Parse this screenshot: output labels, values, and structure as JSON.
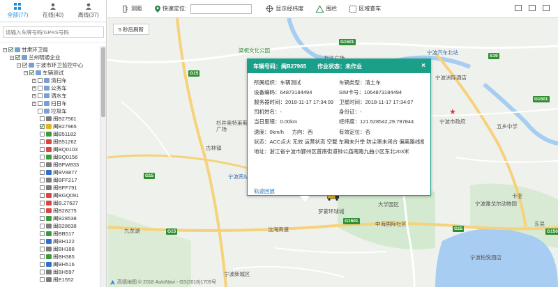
{
  "tabs": [
    {
      "label": "全部(77)",
      "icon": "grid-icon",
      "active": true
    },
    {
      "label": "在线(40)",
      "icon": "user-online-icon",
      "active": false
    },
    {
      "label": "离线(37)",
      "icon": "user-offline-icon",
      "active": false
    }
  ],
  "search": {
    "placeholder": "请输入车牌号码/GPRS号码"
  },
  "tree": {
    "root": "甘肃环卫局",
    "company": "兰州明通企业",
    "center": "宁波市环卫监控中心",
    "group": "车辆测试",
    "categories": [
      "清扫车",
      "公务车",
      "洒水车",
      "扫日车",
      "垃圾车"
    ],
    "plates": [
      {
        "plate": "闽B27561",
        "color": "grey",
        "checked": false
      },
      {
        "plate": "闽B27965",
        "color": "yellow",
        "checked": true
      },
      {
        "plate": "闽B51182",
        "color": "green",
        "checked": false
      },
      {
        "plate": "闽B51262",
        "color": "red",
        "checked": false
      },
      {
        "plate": "闽BQ0103",
        "color": "red",
        "checked": false
      },
      {
        "plate": "闽BQ0156",
        "color": "green",
        "checked": false
      },
      {
        "plate": "闽BFW833",
        "color": "grey",
        "checked": false
      },
      {
        "plate": "闽BV8877",
        "color": "blue",
        "checked": false
      },
      {
        "plate": "闽BFF217",
        "color": "grey",
        "checked": false
      },
      {
        "plate": "闽BFF791",
        "color": "grey",
        "checked": false
      },
      {
        "plate": "闽BGQ091",
        "color": "red",
        "checked": false
      },
      {
        "plate": "闽B.27627",
        "color": "red",
        "checked": false
      },
      {
        "plate": "闽B28275",
        "color": "red",
        "checked": false
      },
      {
        "plate": "闽B28538",
        "color": "green",
        "checked": false
      },
      {
        "plate": "闽B28638",
        "color": "grey",
        "checked": false
      },
      {
        "plate": "闽BB517",
        "color": "green",
        "checked": false
      },
      {
        "plate": "闽BH122",
        "color": "blue",
        "checked": false
      },
      {
        "plate": "闽BH188",
        "color": "grey",
        "checked": false
      },
      {
        "plate": "闽BH385",
        "color": "green",
        "checked": false
      },
      {
        "plate": "闽BH516",
        "color": "blue",
        "checked": false
      },
      {
        "plate": "闽BH597",
        "color": "grey",
        "checked": false
      },
      {
        "plate": "闽E1552",
        "color": "grey",
        "checked": false
      }
    ]
  },
  "toolbar": {
    "ranging": "测距",
    "quick_locate": "快速定位:",
    "show_lnglat": "显示经纬度",
    "fence": "围栏",
    "area_search": "区域查车"
  },
  "map": {
    "refresh": "5 秒后刷新",
    "copyright": "高德地图 © 2018 AutoNavi - GS(2018)1709号",
    "labels": [
      {
        "t": "梁祝文化公园",
        "c": "green"
      },
      {
        "t": "万达广场",
        "c": "dark"
      },
      {
        "t": "宁波汽车北站",
        "c": "blue"
      },
      {
        "t": "宁波洲际酒店",
        "c": "dark"
      },
      {
        "t": "宁波市政府",
        "c": "dark"
      },
      {
        "t": "五乡中学",
        "c": "dark"
      },
      {
        "t": "杉井奥特莱斯广场",
        "c": "dark"
      },
      {
        "t": "古林镇",
        "c": "dark"
      },
      {
        "t": "宁波南站",
        "c": "blue"
      },
      {
        "t": "罗蒙环球城",
        "c": "dark"
      },
      {
        "t": "大学园区",
        "c": "dark"
      },
      {
        "t": "中海国际社区",
        "c": "dark"
      },
      {
        "t": "宁波雅戈尔动物园",
        "c": "dark"
      },
      {
        "t": "宁波柏悦酒店",
        "c": "dark"
      },
      {
        "t": "宁波新城区",
        "c": "dark"
      },
      {
        "t": "沈海高速",
        "c": "dark"
      },
      {
        "t": "卡亚",
        "c": "dark"
      },
      {
        "t": "东吴",
        "c": "dark"
      },
      {
        "t": "九龙湖",
        "c": "dark"
      }
    ],
    "shields": [
      "G15",
      "G1501",
      "S19",
      "G1501",
      "G15",
      "G15",
      "G1501",
      "G1501",
      "G15"
    ]
  },
  "popup": {
    "plate_label": "车辆号码：闽B27965",
    "status_label": "作业状态：未作业",
    "close": "×",
    "rows": [
      [
        "所属组织：车辆测试",
        "车辆类型：清土车"
      ],
      [
        "设备编码：64873184494",
        "SIM卡号：1064873184494"
      ],
      [
        "服务器时间：2018-11-17 17:34:09",
        "卫星时间：2018-11-17 17:34:07"
      ],
      [
        "司机姓名：-",
        "身份证：-"
      ],
      [
        "当日里程：0.00km",
        "经纬度：121.528542,29.797844"
      ],
      [
        "速度：0km/h",
        "方向：西",
        "有效定位：否"
      ]
    ],
    "state": "状态：ACC点火 无效 运营状态 空载 车厢未升举 防尘罩未闭合 偏离路线报...",
    "address": "地址：浙江省宁波市鄞州区首南街道钟公庙南路九曲小区东北203米",
    "track": "轨迹回放"
  }
}
